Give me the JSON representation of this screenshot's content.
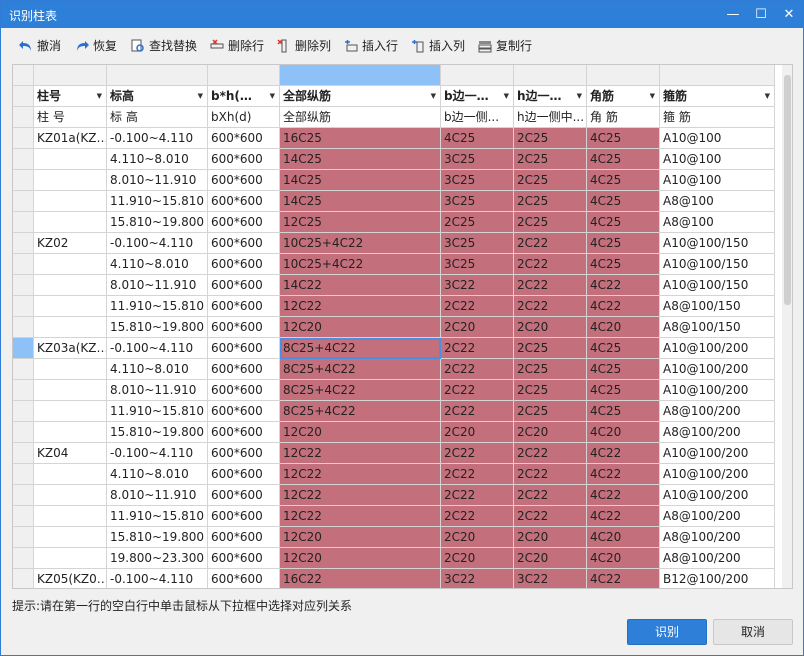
{
  "window": {
    "title": "识别柱表"
  },
  "toolbar": {
    "undo": "撤消",
    "redo": "恢复",
    "find_replace": "查找替换",
    "delete_row": "删除行",
    "delete_col": "删除列",
    "insert_row": "插入行",
    "insert_col": "插入列",
    "copy_row": "复制行"
  },
  "grid": {
    "columns": [
      "柱号",
      "标高",
      "b*h(…",
      "全部纵筋",
      "b边一…",
      "h边一…",
      "角筋",
      "箍筋"
    ],
    "subheaders": [
      "柱 号",
      "标 高",
      "bXh(d)",
      "全部纵筋",
      "b边一侧...",
      "h边一侧中...",
      "角 筋",
      "箍 筋"
    ],
    "rows": [
      [
        "KZ01a(KZ…",
        "-0.100~4.110",
        "600*600",
        "16C25",
        "4C25",
        "2C25",
        "4C25",
        "A10@100"
      ],
      [
        "",
        "4.110~8.010",
        "600*600",
        "14C25",
        "3C25",
        "2C25",
        "4C25",
        "A10@100"
      ],
      [
        "",
        "8.010~11.910",
        "600*600",
        "14C25",
        "3C25",
        "2C25",
        "4C25",
        "A10@100"
      ],
      [
        "",
        "11.910~15.810",
        "600*600",
        "14C25",
        "3C25",
        "2C25",
        "4C25",
        "A8@100"
      ],
      [
        "",
        "15.810~19.800",
        "600*600",
        "12C25",
        "2C25",
        "2C25",
        "4C25",
        "A8@100"
      ],
      [
        "KZ02",
        "-0.100~4.110",
        "600*600",
        "10C25+4C22",
        "3C25",
        "2C22",
        "4C25",
        "A10@100/150"
      ],
      [
        "",
        "4.110~8.010",
        "600*600",
        "10C25+4C22",
        "3C25",
        "2C22",
        "4C25",
        "A10@100/150"
      ],
      [
        "",
        "8.010~11.910",
        "600*600",
        "14C22",
        "3C22",
        "2C22",
        "4C22",
        "A10@100/150"
      ],
      [
        "",
        "11.910~15.810",
        "600*600",
        "12C22",
        "2C22",
        "2C22",
        "4C22",
        "A8@100/150"
      ],
      [
        "",
        "15.810~19.800",
        "600*600",
        "12C20",
        "2C20",
        "2C20",
        "4C20",
        "A8@100/150"
      ],
      [
        "KZ03a(KZ…",
        "-0.100~4.110",
        "600*600",
        "8C25+4C22",
        "2C22",
        "2C25",
        "4C25",
        "A10@100/200"
      ],
      [
        "",
        "4.110~8.010",
        "600*600",
        "8C25+4C22",
        "2C22",
        "2C25",
        "4C25",
        "A10@100/200"
      ],
      [
        "",
        "8.010~11.910",
        "600*600",
        "8C25+4C22",
        "2C22",
        "2C25",
        "4C25",
        "A10@100/200"
      ],
      [
        "",
        "11.910~15.810",
        "600*600",
        "8C25+4C22",
        "2C22",
        "2C25",
        "4C25",
        "A8@100/200"
      ],
      [
        "",
        "15.810~19.800",
        "600*600",
        "12C20",
        "2C20",
        "2C20",
        "4C20",
        "A8@100/200"
      ],
      [
        "KZ04",
        "-0.100~4.110",
        "600*600",
        "12C22",
        "2C22",
        "2C22",
        "4C22",
        "A10@100/200"
      ],
      [
        "",
        "4.110~8.010",
        "600*600",
        "12C22",
        "2C22",
        "2C22",
        "4C22",
        "A10@100/200"
      ],
      [
        "",
        "8.010~11.910",
        "600*600",
        "12C22",
        "2C22",
        "2C22",
        "4C22",
        "A10@100/200"
      ],
      [
        "",
        "11.910~15.810",
        "600*600",
        "12C22",
        "2C22",
        "2C22",
        "4C22",
        "A8@100/200"
      ],
      [
        "",
        "15.810~19.800",
        "600*600",
        "12C20",
        "2C20",
        "2C20",
        "4C20",
        "A8@100/200"
      ],
      [
        "",
        "19.800~23.300",
        "600*600",
        "12C20",
        "2C20",
        "2C20",
        "4C20",
        "A8@100/200"
      ],
      [
        "KZ05(KZ0…",
        "-0.100~4.110",
        "600*600",
        "16C22",
        "3C22",
        "3C22",
        "4C22",
        "B12@100/200"
      ]
    ]
  },
  "hint": "提示:请在第一行的空白行中单击鼠标从下拉框中选择对应列关系",
  "buttons": {
    "ok": "识别",
    "cancel": "取消"
  }
}
